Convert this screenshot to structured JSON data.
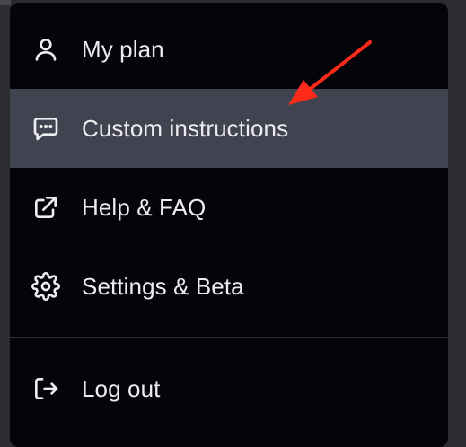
{
  "menu": {
    "items": [
      {
        "label": "My plan",
        "icon": "user-icon",
        "active": false
      },
      {
        "label": "Custom instructions",
        "icon": "message-dots-icon",
        "active": true
      },
      {
        "label": "Help & FAQ",
        "icon": "external-link-icon",
        "active": false
      },
      {
        "label": "Settings & Beta",
        "icon": "gear-icon",
        "active": false
      }
    ],
    "logout": {
      "label": "Log out",
      "icon": "logout-icon"
    }
  },
  "colors": {
    "menu_background": "#050509",
    "active_background": "#414350",
    "text": "#ececf1",
    "annotation_arrow": "#ff2a1a"
  }
}
